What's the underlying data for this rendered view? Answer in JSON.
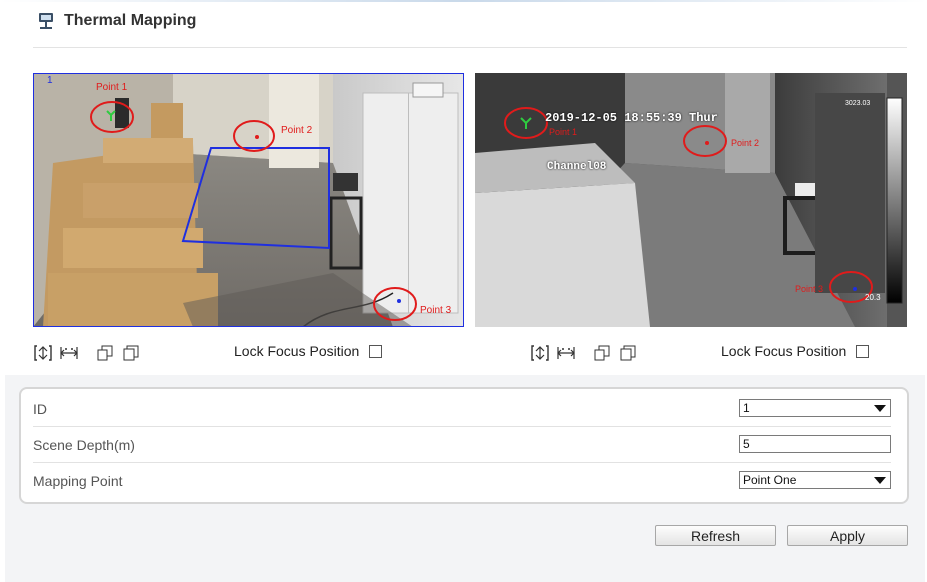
{
  "header": {
    "title": "Thermal Mapping",
    "icon": "thermal-mapping-icon"
  },
  "left_video": {
    "channel_index": "1",
    "points": [
      {
        "label": "Point 1"
      },
      {
        "label": "Point 2"
      },
      {
        "label": "Point 3"
      }
    ]
  },
  "right_video": {
    "osd_datetime": "2019-12-05 18:55:39 Thur",
    "osd_channel": "Channel08",
    "temp_max": "3023.03",
    "temp_min": "20.3",
    "points": [
      {
        "label": "Point 1"
      },
      {
        "label": "Point 2"
      },
      {
        "label": "Point 3"
      }
    ]
  },
  "toolbar": {
    "icons": [
      "zoom-in-icon",
      "zoom-out-icon",
      "copy-icon",
      "copy-alt-icon"
    ],
    "lock_focus_label": "Lock Focus Position"
  },
  "form": {
    "id_label": "ID",
    "id_value": "1",
    "scene_depth_label": "Scene Depth(m)",
    "scene_depth_value": "5",
    "mapping_point_label": "Mapping Point",
    "mapping_point_value": "Point One"
  },
  "buttons": {
    "refresh": "Refresh",
    "apply": "Apply"
  },
  "colors": {
    "region_blue": "#1f2fe0",
    "marker_red": "#e01b1b",
    "marker_green": "#2ecc40"
  }
}
